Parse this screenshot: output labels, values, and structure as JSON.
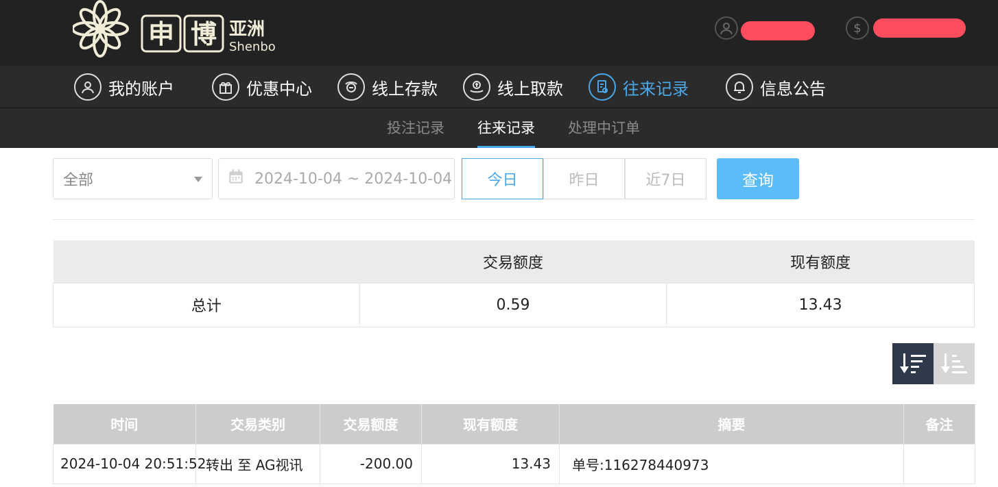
{
  "header": {
    "logo_text": "申博",
    "logo_sub_cn": "亚洲",
    "logo_sub_en": "Shenbo"
  },
  "nav": {
    "items": [
      {
        "label": "我的账户",
        "icon": "user-icon"
      },
      {
        "label": "优惠中心",
        "icon": "gift-icon"
      },
      {
        "label": "线上存款",
        "icon": "deposit-icon"
      },
      {
        "label": "线上取款",
        "icon": "withdraw-icon"
      },
      {
        "label": "往来记录",
        "icon": "records-icon",
        "active": true
      },
      {
        "label": "信息公告",
        "icon": "bell-icon"
      }
    ]
  },
  "subnav": {
    "items": [
      {
        "label": "投注记录"
      },
      {
        "label": "往来记录",
        "active": true
      },
      {
        "label": "处理中订单"
      }
    ]
  },
  "filter": {
    "type_value": "全部",
    "date_range": "2024-10-04 ~ 2024-10-04",
    "today": "今日",
    "yesterday": "昨日",
    "last7": "近7日",
    "query": "查询"
  },
  "summary": {
    "headers": [
      "",
      "交易额度",
      "现有额度"
    ],
    "row": [
      "总计",
      "0.59",
      "13.43"
    ]
  },
  "records": {
    "headers": [
      "时间",
      "交易类别",
      "交易额度",
      "现有额度",
      "摘要",
      "备注"
    ],
    "rows": [
      [
        "2024-10-04 20:51:52",
        "转出 至 AG视讯",
        "-200.00",
        "13.43",
        "单号:116278440973",
        ""
      ]
    ]
  },
  "colors": {
    "accent": "#4aa8ea",
    "header_bg": "#222222",
    "query_button": "#5bbcf8",
    "redacted": "#ff4d5e"
  }
}
